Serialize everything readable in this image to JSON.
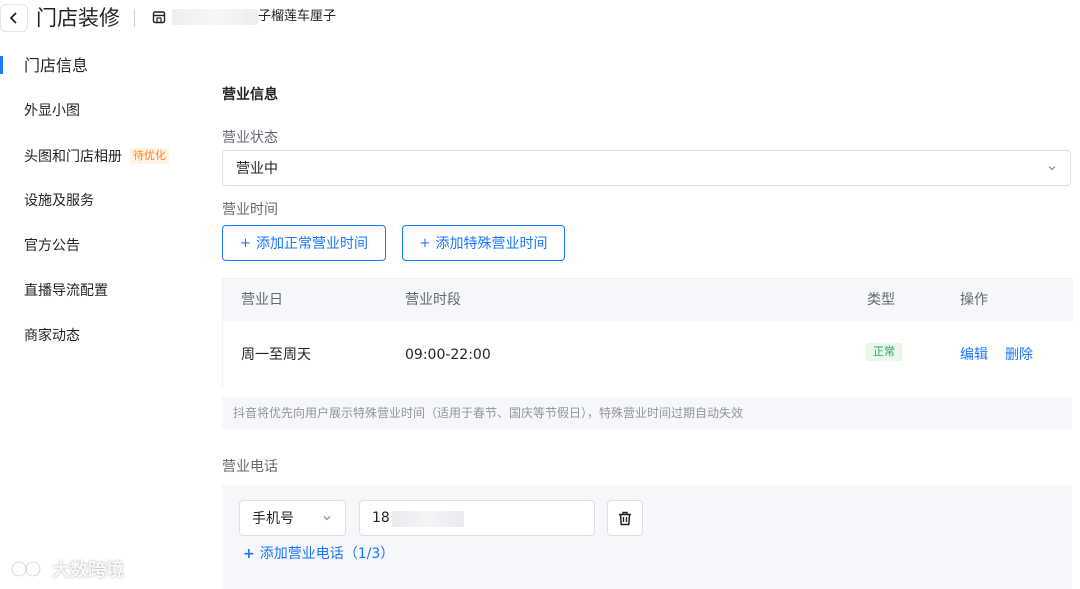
{
  "header": {
    "title": "门店装修",
    "store_name": "子榴莲车厘子"
  },
  "sidebar": {
    "items": [
      {
        "label": "门店信息",
        "active": true
      },
      {
        "label": "外显小图"
      },
      {
        "label": "头图和门店相册",
        "badge": "待优化"
      },
      {
        "label": "设施及服务"
      },
      {
        "label": "官方公告"
      },
      {
        "label": "直播导流配置"
      },
      {
        "label": "商家动态"
      }
    ]
  },
  "main": {
    "section_title": "营业信息",
    "status": {
      "label": "营业状态",
      "value": "营业中"
    },
    "hours": {
      "label": "营业时间",
      "add_normal_label": "添加正常营业时间",
      "add_special_label": "添加特殊营业时间",
      "table": {
        "headers": [
          "营业日",
          "营业时段",
          "类型",
          "操作"
        ],
        "rows": [
          {
            "days": "周一至周天",
            "time": "09:00-22:00",
            "type": "正常",
            "actions": [
              "编辑",
              "删除"
            ]
          }
        ]
      },
      "note": "抖音将优先向用户展示特殊营业时间（适用于春节、国庆等节假日），特殊营业时间过期自动失效"
    },
    "phone": {
      "label": "营业电话",
      "type_value": "手机号",
      "number_prefix": "18",
      "add_label": "添加营业电话（1/3）"
    }
  },
  "watermark": "大数跨境",
  "colors": {
    "accent": "#1a76ff",
    "badge_text": "#f5862a",
    "tag_green": "#2ea85a"
  }
}
